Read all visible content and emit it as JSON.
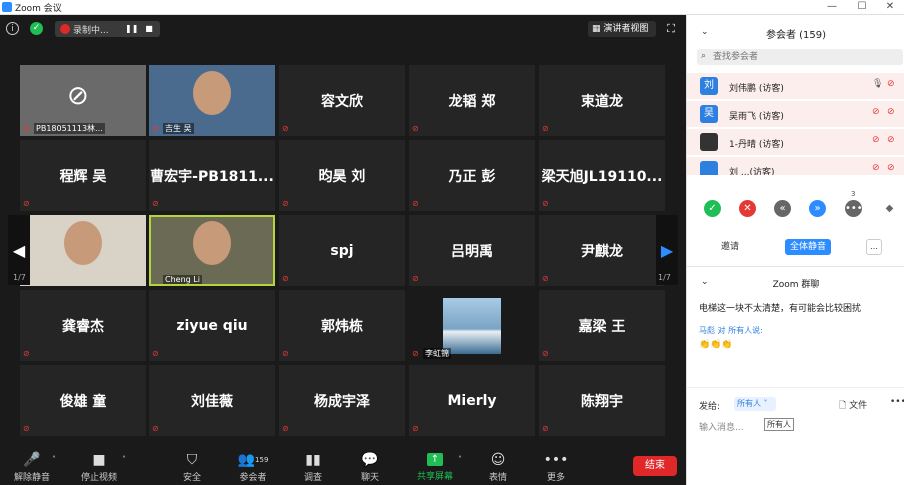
{
  "window": {
    "title": "Zoom 会议"
  },
  "topbar": {
    "recording_label": "录制中...",
    "speaker_view_label": "演讲者视图"
  },
  "tiles": [
    {
      "name": "",
      "label": "PB18051113林...",
      "muted": true,
      "type": "camoff"
    },
    {
      "name": "",
      "label": "吉生 吴",
      "muted": true,
      "type": "video"
    },
    {
      "name": "容文欣",
      "label": "",
      "muted": true,
      "type": "text"
    },
    {
      "name": "龙韬 郑",
      "label": "",
      "muted": true,
      "type": "text"
    },
    {
      "name": "束道龙",
      "label": "",
      "muted": true,
      "type": "text"
    },
    {
      "name": "程辉 吴",
      "label": "",
      "muted": true,
      "type": "text"
    },
    {
      "name": "曹宏宇-PB1811...",
      "label": "",
      "muted": true,
      "type": "text"
    },
    {
      "name": "昀昊 刘",
      "label": "",
      "muted": true,
      "type": "text"
    },
    {
      "name": "乃正 彭",
      "label": "",
      "muted": true,
      "type": "text"
    },
    {
      "name": "梁天旭JL19110...",
      "label": "",
      "muted": true,
      "type": "text"
    },
    {
      "name": "",
      "label": "",
      "muted": false,
      "type": "video"
    },
    {
      "name": "",
      "label": "Cheng Li",
      "muted": false,
      "type": "video",
      "active": true
    },
    {
      "name": "spj",
      "label": "",
      "muted": true,
      "type": "text"
    },
    {
      "name": "吕明禹",
      "label": "",
      "muted": true,
      "type": "text"
    },
    {
      "name": "尹麒龙",
      "label": "",
      "muted": true,
      "type": "text"
    },
    {
      "name": "龚睿杰",
      "label": "",
      "muted": true,
      "type": "text"
    },
    {
      "name": "ziyue qiu",
      "label": "",
      "muted": true,
      "type": "text"
    },
    {
      "name": "郭炜栋",
      "label": "",
      "muted": true,
      "type": "text"
    },
    {
      "name": "",
      "label": "李虹锦",
      "muted": true,
      "type": "image"
    },
    {
      "name": "嘉梁 王",
      "label": "",
      "muted": true,
      "type": "text"
    },
    {
      "name": "俊雄 童",
      "label": "",
      "muted": true,
      "type": "text"
    },
    {
      "name": "刘佳薇",
      "label": "",
      "muted": true,
      "type": "text"
    },
    {
      "name": "杨成宇泽",
      "label": "",
      "muted": true,
      "type": "text"
    },
    {
      "name": "Mierly",
      "label": "",
      "muted": true,
      "type": "text"
    },
    {
      "name": "陈翔宇",
      "label": "",
      "muted": true,
      "type": "text"
    }
  ],
  "nav": {
    "left_page": "1/7",
    "right_page": "1/7"
  },
  "toolbar": {
    "unmute": "解除静音",
    "stop_video": "停止视频",
    "security": "安全",
    "participants": "参会者",
    "participants_count": "159",
    "poll": "调查",
    "chat": "聊天",
    "share": "共享屏幕",
    "reactions": "表情",
    "more": "更多",
    "end": "结束"
  },
  "participants_panel": {
    "title": "参会者 (159)",
    "search_placeholder": "查找参会者",
    "items": [
      {
        "avatar": "刘",
        "name": "刘伟鹏 (访客)"
      },
      {
        "avatar": "吴",
        "name": "吴雨飞 (访客)"
      },
      {
        "avatar": "",
        "name": "1-丹晴 (访客)"
      },
      {
        "avatar": "",
        "name": "刘 ...(访客)"
      }
    ],
    "count_badge": "3",
    "invite": "邀请",
    "mute_all": "全体静音",
    "more": "..."
  },
  "chat": {
    "title": "Zoom 群聊",
    "message1": "电梯这一块不太清楚，有可能会比较困扰",
    "sender": "马彪 对 所有人说:",
    "message2": "👏👏👏",
    "to_label": "发给:",
    "to_value": "所有人",
    "file": "文件",
    "input_placeholder": "输入消息...",
    "tooltip": "所有人"
  }
}
